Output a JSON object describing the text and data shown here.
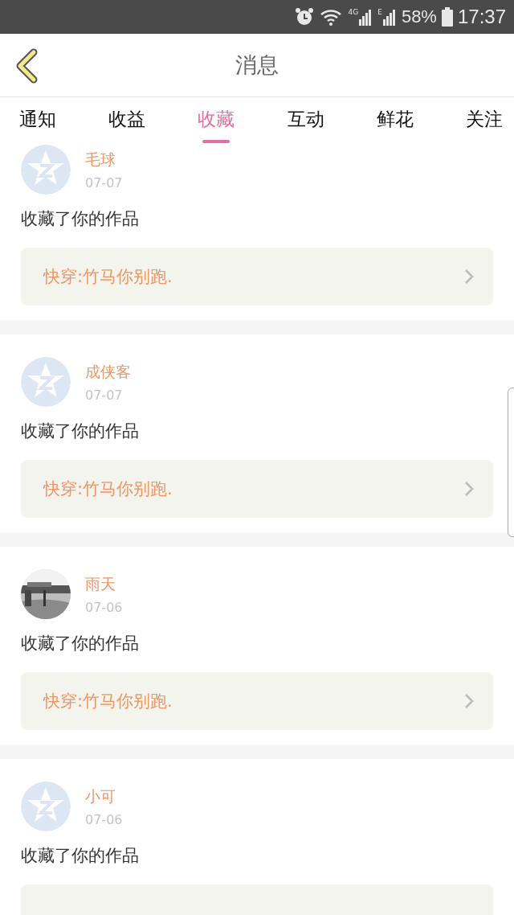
{
  "status_bar": {
    "networks": [
      {
        "label": "4G"
      },
      {
        "label": "E"
      }
    ],
    "battery": "58%",
    "time": "17:37"
  },
  "header": {
    "title": "消息"
  },
  "tabs": [
    {
      "label": "通知",
      "selected": false
    },
    {
      "label": "收益",
      "selected": false
    },
    {
      "label": "收藏",
      "selected": true
    },
    {
      "label": "互动",
      "selected": false
    },
    {
      "label": "鲜花",
      "selected": false
    },
    {
      "label": "关注",
      "selected": false
    }
  ],
  "messages": [
    {
      "avatar": {
        "kind": "default"
      },
      "name": "毛球",
      "date": "07-07",
      "text": "收藏了你的作品",
      "work": "快穿:竹马你别跑."
    },
    {
      "avatar": {
        "kind": "default"
      },
      "name": "成侠客",
      "date": "07-07",
      "text": "收藏了你的作品",
      "work": "快穿:竹马你别跑."
    },
    {
      "name": "雨天",
      "date": "07-06",
      "text": "收藏了你的作品",
      "work": "快穿:竹马你别跑."
    },
    {
      "avatar": {
        "kind": "default"
      },
      "name": "小可",
      "date": "07-06",
      "text": "收藏了你的作品"
    }
  ]
}
